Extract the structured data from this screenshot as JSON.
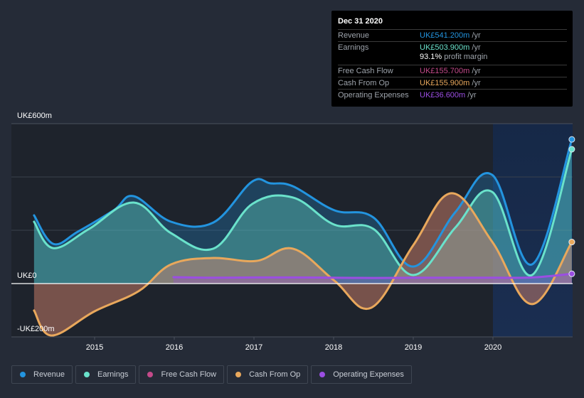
{
  "chart_data": {
    "type": "area",
    "title": "",
    "xlabel": "",
    "ylabel": "",
    "ylim": [
      -200,
      600
    ],
    "xlim": [
      2014.24,
      2020.99
    ],
    "y_ticks": [
      {
        "value": 600,
        "label": "UK£600m"
      },
      {
        "value": 0,
        "label": "UK£0"
      },
      {
        "value": -200,
        "label": "-UK£200m"
      }
    ],
    "y_gridlines": [
      600,
      400,
      200,
      0,
      -200
    ],
    "x_ticks": [
      {
        "value": 2015,
        "label": "2015"
      },
      {
        "value": 2016,
        "label": "2016"
      },
      {
        "value": 2017,
        "label": "2017"
      },
      {
        "value": 2018,
        "label": "2018"
      },
      {
        "value": 2019,
        "label": "2019"
      },
      {
        "value": 2020,
        "label": "2020"
      }
    ],
    "highlight_from": 2020.0,
    "grid": true,
    "legend_position": "bottom-left",
    "series": [
      {
        "name": "Revenue",
        "color": "#2394df",
        "x": [
          2014.24,
          2014.48,
          2014.79,
          2015.24,
          2015.49,
          2015.96,
          2016.49,
          2016.97,
          2017.21,
          2017.49,
          2018.01,
          2018.5,
          2019.0,
          2019.53,
          2019.99,
          2020.49,
          2020.99
        ],
        "values": [
          256,
          149,
          195,
          275,
          328,
          232,
          229,
          381,
          376,
          365,
          275,
          248,
          64,
          269,
          408,
          72,
          541
        ]
      },
      {
        "name": "Earnings",
        "color": "#6ae2cb",
        "x": [
          2014.24,
          2014.48,
          2014.93,
          2015.49,
          2015.96,
          2016.49,
          2016.98,
          2017.49,
          2018.01,
          2018.5,
          2019.0,
          2019.53,
          2019.99,
          2020.49,
          2020.99
        ],
        "values": [
          232,
          133,
          205,
          304,
          189,
          131,
          299,
          323,
          221,
          205,
          32,
          211,
          344,
          32,
          504
        ]
      },
      {
        "name": "Free Cash Flow",
        "color": "#c44a8a",
        "x": [
          2014.24,
          2014.46,
          2015.0,
          2015.55,
          2015.96,
          2016.49,
          2017.03,
          2017.49,
          2018.01,
          2018.47,
          2019.0,
          2019.48,
          2019.99,
          2020.49,
          2020.99
        ],
        "values": [
          -101,
          -195,
          -104,
          -29,
          72,
          96,
          85,
          131,
          11,
          -91,
          144,
          339,
          157,
          -77,
          155.7
        ]
      },
      {
        "name": "Cash From Op",
        "color": "#e9a85c",
        "x": [
          2014.24,
          2014.46,
          2015.0,
          2015.55,
          2015.96,
          2016.49,
          2017.03,
          2017.49,
          2018.01,
          2018.47,
          2019.0,
          2019.48,
          2019.99,
          2020.49,
          2020.99
        ],
        "values": [
          -101,
          -195,
          -104,
          -29,
          72,
          96,
          85,
          131,
          11,
          -91,
          144,
          339,
          157,
          -77,
          155.9
        ]
      },
      {
        "name": "Operating Expenses",
        "color": "#9b4ee2",
        "x": [
          2015.99,
          2016.5,
          2017.0,
          2017.5,
          2018.0,
          2018.5,
          2019.0,
          2019.5,
          2020.0,
          2020.5,
          2020.99
        ],
        "values": [
          24,
          22,
          23,
          23,
          22,
          21,
          22,
          22,
          22,
          23,
          36.6
        ]
      }
    ]
  },
  "tooltip": {
    "date": "Dec 31 2020",
    "rows": [
      {
        "label": "Revenue",
        "value": "UK£541.200m",
        "unit": " /yr",
        "color": "#2394df"
      },
      {
        "label": "Earnings",
        "value": "UK£503.900m",
        "unit": " /yr",
        "color": "#6ae2cb"
      },
      {
        "label": "Free Cash Flow",
        "value": "UK£155.700m",
        "unit": " /yr",
        "color": "#c44a8a"
      },
      {
        "label": "Cash From Op",
        "value": "UK£155.900m",
        "unit": " /yr",
        "color": "#e9a85c"
      },
      {
        "label": "Operating Expenses",
        "value": "UK£36.600m",
        "unit": " /yr",
        "color": "#9b4ee2"
      }
    ],
    "margin_value": "93.1%",
    "margin_label": " profit margin"
  },
  "legend": [
    {
      "label": "Revenue",
      "color": "#2394df"
    },
    {
      "label": "Earnings",
      "color": "#6ae2cb"
    },
    {
      "label": "Free Cash Flow",
      "color": "#c44a8a"
    },
    {
      "label": "Cash From Op",
      "color": "#e9a85c"
    },
    {
      "label": "Operating Expenses",
      "color": "#9b4ee2"
    }
  ]
}
